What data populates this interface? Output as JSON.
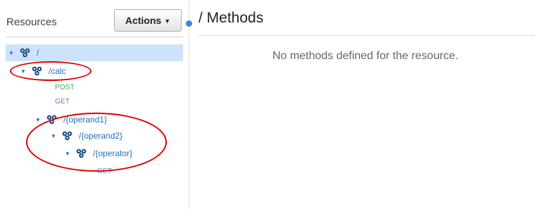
{
  "sidebar": {
    "title": "Resources",
    "actions_label": "Actions",
    "tree": [
      {
        "path": "/",
        "expanded": true,
        "selected": true
      },
      {
        "path": "/calc",
        "expanded": true,
        "methods": [
          "POST",
          "GET"
        ]
      },
      {
        "path": "/{operand1}",
        "expanded": true
      },
      {
        "path": "/{operand2}",
        "expanded": true
      },
      {
        "path": "/{operator}",
        "expanded": true,
        "methods": [
          "GET"
        ]
      }
    ]
  },
  "main": {
    "title": "/ Methods",
    "empty_message": "No methods defined for the resource."
  },
  "colors": {
    "post": "#3daa49",
    "get": "#4d89c7",
    "annotation": "#e00000",
    "selected_row": "#cce3fb"
  }
}
